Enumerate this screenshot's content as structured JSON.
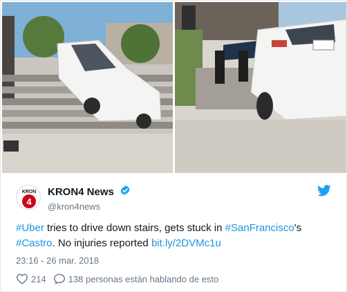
{
  "tweet": {
    "author_name": "KRON4 News",
    "author_handle": "@kron4news",
    "avatar_text": "KRON",
    "avatar_number": "4",
    "text_segments": [
      {
        "text": "#Uber",
        "type": "hashtag"
      },
      {
        "text": " tries to drive down stairs, gets stuck in ",
        "type": "text"
      },
      {
        "text": "#SanFrancisco",
        "type": "hashtag"
      },
      {
        "text": "'s ",
        "type": "text"
      },
      {
        "text": "#Castro",
        "type": "hashtag"
      },
      {
        "text": ". No injuries reported ",
        "type": "text"
      },
      {
        "text": "bit.ly/2DVMc1u",
        "type": "link"
      }
    ],
    "timestamp": "23:16 - 26 mar. 2018",
    "likes": "214",
    "replies_text": "138 personas están hablando de esto"
  },
  "icons": {
    "verified": "verified-badge-icon",
    "brand": "twitter-bird-icon",
    "like": "heart-icon",
    "reply": "speech-bubble-icon"
  },
  "colors": {
    "link": "#1b95e0",
    "secondary_text": "#657786",
    "avatar_red": "#d0021b",
    "twitter_blue": "#1da1f2"
  }
}
